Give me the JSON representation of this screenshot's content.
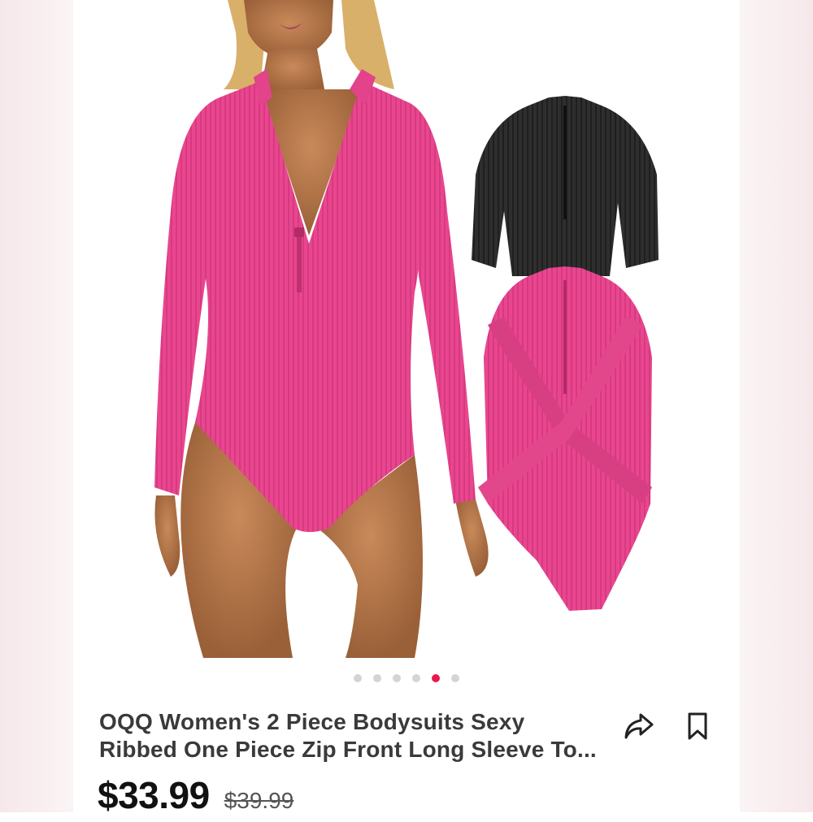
{
  "gallery": {
    "image_alt": "Woman wearing pink ribbed zip-front long sleeve bodysuit with black and pink bodysuits shown",
    "dots_count": 6,
    "active_index": 4
  },
  "product": {
    "title_line1": "OQQ Women's 2 Piece Bodysuits Sexy",
    "title_line2": "Ribbed One Piece Zip Front Long Sleeve To...",
    "price": "$33.99",
    "original_price": "$39.99"
  },
  "actions": {
    "share_icon": "share-arrow-icon",
    "save_icon": "bookmark-icon"
  },
  "colors": {
    "accent": "#e8184f",
    "product_pink": "#e9468f",
    "product_black": "#2b2b2b"
  }
}
